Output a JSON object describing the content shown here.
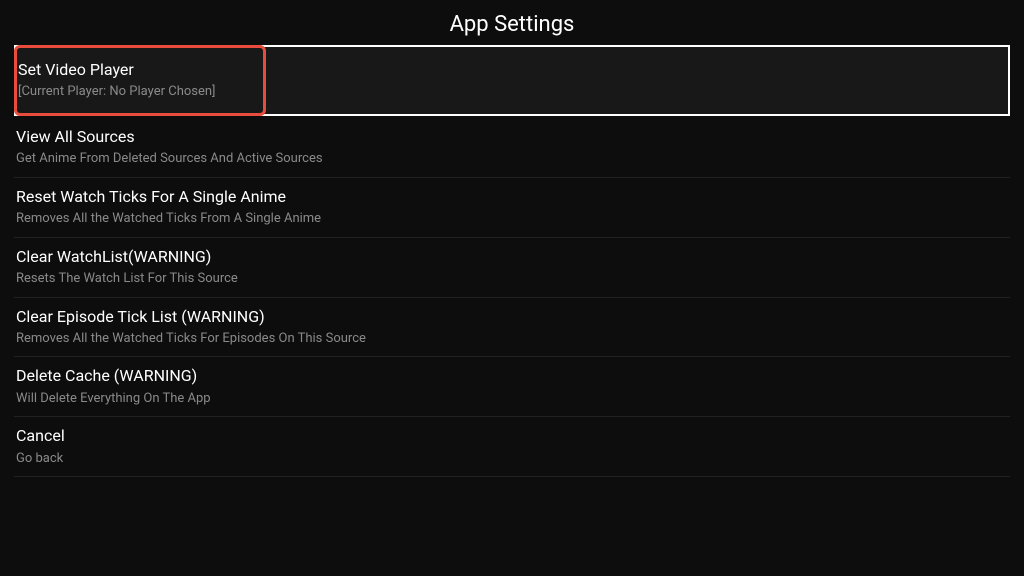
{
  "title": "App Settings",
  "items": [
    {
      "title": "Set Video Player",
      "sub": "[Current Player: No Player Chosen]",
      "focused": true,
      "highlight": true
    },
    {
      "title": "View All Sources",
      "sub": "Get Anime From Deleted Sources And Active Sources"
    },
    {
      "title": "Reset Watch Ticks For A Single Anime",
      "sub": "Removes All the Watched Ticks From A Single Anime"
    },
    {
      "title": "Clear WatchList(WARNING)",
      "sub": "Resets The Watch List For This Source"
    },
    {
      "title": "Clear Episode Tick List (WARNING)",
      "sub": "Removes All the Watched Ticks For Episodes On This Source"
    },
    {
      "title": "Delete Cache (WARNING)",
      "sub": "Will Delete Everything On The App"
    },
    {
      "title": "Cancel",
      "sub": "Go back"
    }
  ]
}
